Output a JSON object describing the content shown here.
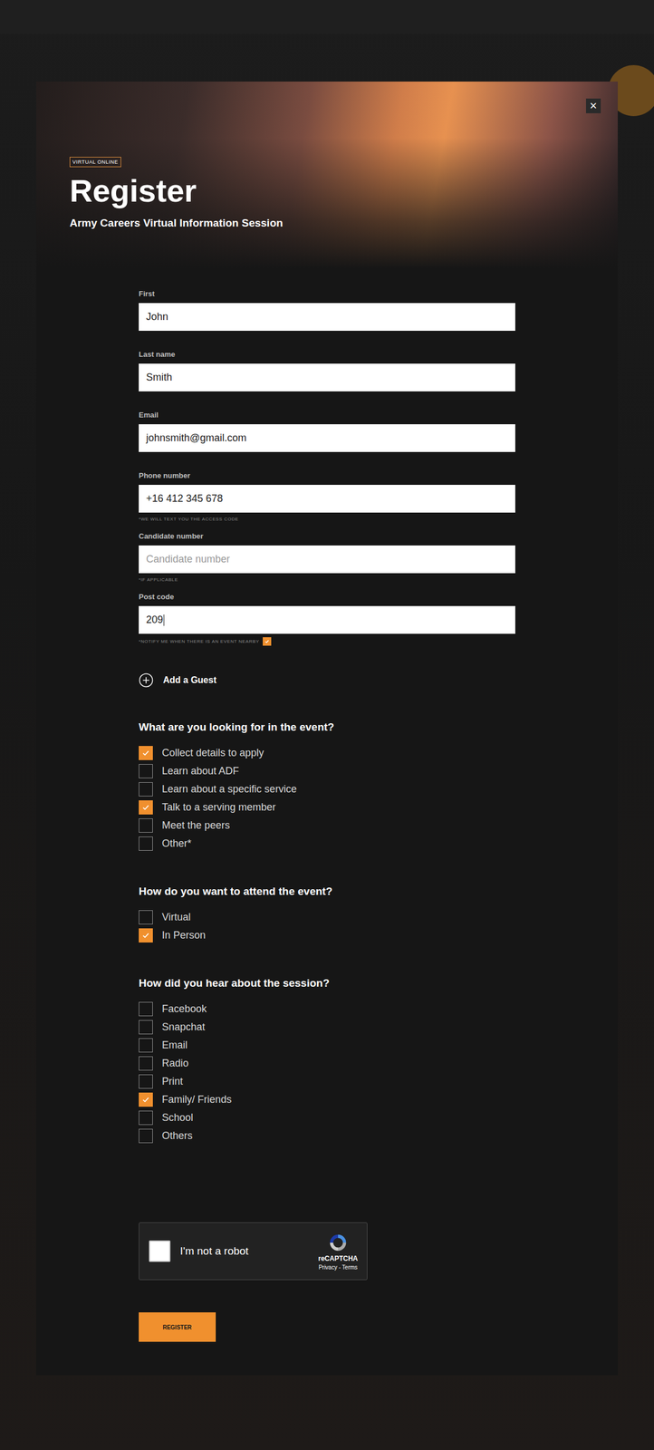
{
  "badge": "VIRTUAL ONLINE",
  "title": "Register",
  "subtitle": "Army Careers Virtual Information Session",
  "close": "×",
  "fields": [
    {
      "label": "First",
      "value": "John",
      "placeholder": "",
      "focused": false,
      "hint": null
    },
    {
      "label": "Last name",
      "value": "Smith",
      "placeholder": "",
      "focused": false,
      "hint": null
    },
    {
      "label": "Email",
      "value": "johnsmith@gmail.com",
      "placeholder": "",
      "focused": false,
      "hint": null
    },
    {
      "label": "Phone number",
      "value": "+16 412 345 678",
      "placeholder": "",
      "focused": false,
      "hint": {
        "text": "*WE WILL TEXT YOU THE ACCESS CODE",
        "kind": "note",
        "checked": false
      }
    },
    {
      "label": "Candidate number",
      "value": "",
      "placeholder": "Candidate number",
      "focused": false,
      "hint": {
        "text": "*IF APPLICABLE",
        "kind": "note",
        "checked": false
      }
    },
    {
      "label": "Post code",
      "value": "209",
      "placeholder": "",
      "focused": true,
      "hint": {
        "text": "*NOTIFY ME WHEN THERE IS AN EVENT NEARBY",
        "kind": "checkbox",
        "checked": true
      }
    }
  ],
  "add_guest": "Add a Guest",
  "questions": [
    {
      "title": "What are you looking for in the event?",
      "options": [
        {
          "label": "Collect details to apply",
          "checked": true
        },
        {
          "label": "Learn about ADF",
          "checked": false
        },
        {
          "label": "Learn about a specific service",
          "checked": false
        },
        {
          "label": "Talk to a serving member",
          "checked": true
        },
        {
          "label": "Meet the peers",
          "checked": false
        },
        {
          "label": "Other*",
          "checked": false
        }
      ]
    },
    {
      "title": "How do you want to attend the event?",
      "options": [
        {
          "label": "Virtual",
          "checked": false
        },
        {
          "label": "In Person",
          "checked": true
        }
      ]
    },
    {
      "title": "How did you hear about the session?",
      "options": [
        {
          "label": "Facebook",
          "checked": false
        },
        {
          "label": "Snapchat",
          "checked": false
        },
        {
          "label": "Email",
          "checked": false
        },
        {
          "label": "Radio",
          "checked": false
        },
        {
          "label": "Print",
          "checked": false
        },
        {
          "label": "Family/ Friends",
          "checked": true
        },
        {
          "label": "School",
          "checked": false
        },
        {
          "label": "Others",
          "checked": false
        }
      ]
    }
  ],
  "captcha": {
    "label": "I'm not a robot",
    "checked": false,
    "brand": "reCAPTCHA",
    "links": "Privacy - Terms"
  },
  "submit": "REGISTER"
}
